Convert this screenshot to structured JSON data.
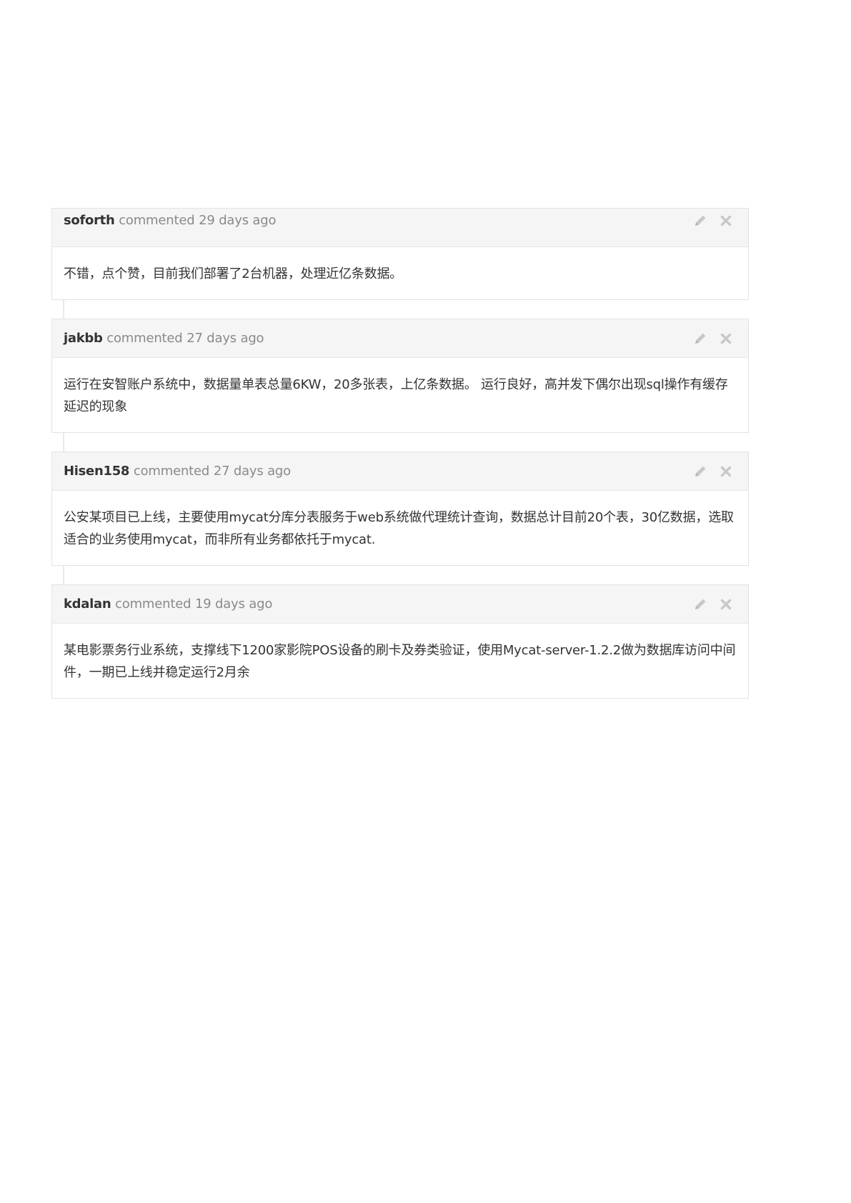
{
  "comments": [
    {
      "author": "soforth",
      "action": "commented",
      "time": "29 days ago",
      "body": "不错，点个赞，目前我们部署了2台机器，处理近亿条数据。"
    },
    {
      "author": "jakbb",
      "action": "commented",
      "time": "27 days ago",
      "body": "运行在安智账户系统中，数据量单表总量6KW，20多张表，上亿条数据。 运行良好，高并发下偶尔出现sql操作有缓存延迟的现象"
    },
    {
      "author": "Hisen158",
      "action": "commented",
      "time": "27 days ago",
      "body": "公安某项目已上线，主要使用mycat分库分表服务于web系统做代理统计查询，数据总计目前20个表，30亿数据，选取适合的业务使用mycat，而非所有业务都依托于mycat."
    },
    {
      "author": "kdalan",
      "action": "commented",
      "time": "19 days ago",
      "body": "某电影票务行业系统，支撑线下1200家影院POS设备的刷卡及券类验证，使用Mycat-server-1.2.2做为数据库访问中间件，一期已上线并稳定运行2月余"
    }
  ],
  "icons": {
    "edit": "pencil-icon",
    "delete": "close-icon"
  },
  "colors": {
    "header_bg": "#f5f5f5",
    "border": "#e3e3e3",
    "author_text": "#333333",
    "meta_text": "#8a8a8a",
    "icon": "#c8c8c8"
  }
}
